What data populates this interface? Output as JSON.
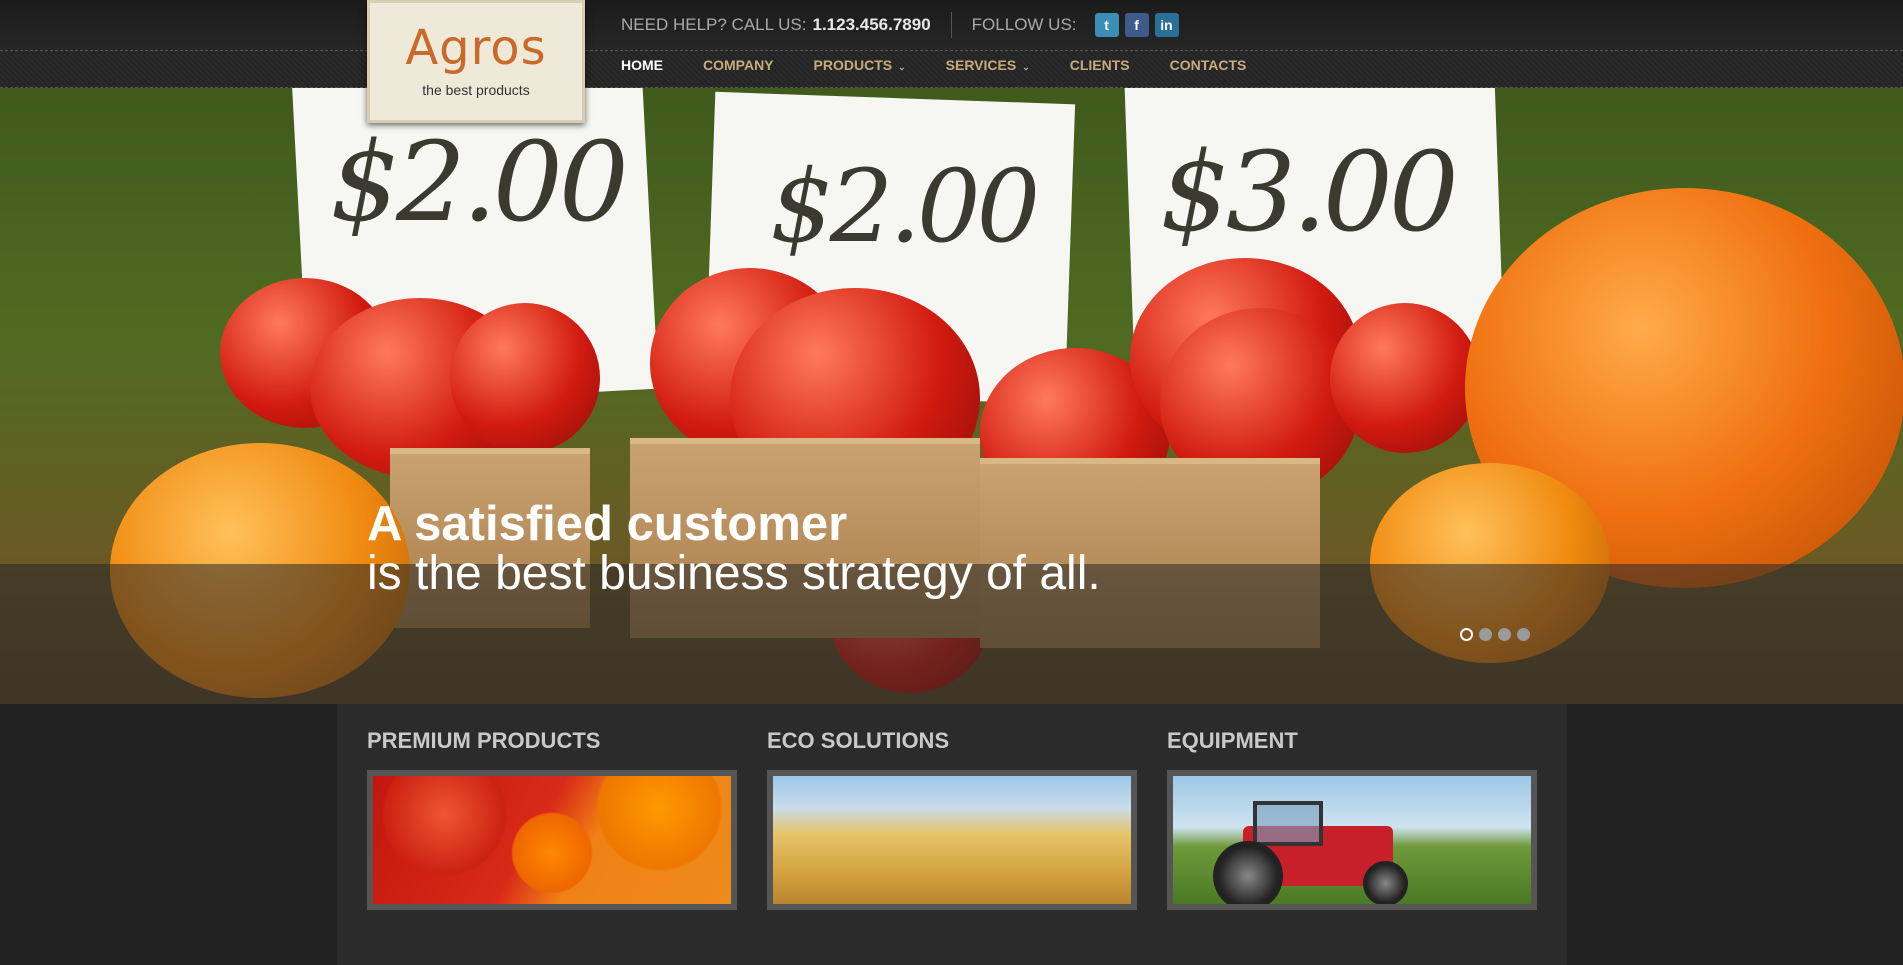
{
  "header": {
    "logo": {
      "name": "Agros",
      "tagline": "the best products"
    },
    "help_label": "NEED HELP? CALL US:",
    "phone": "1.123.456.7890",
    "follow_label": "FOLLOW US:",
    "social": [
      {
        "name": "twitter-icon",
        "glyph": "t"
      },
      {
        "name": "facebook-icon",
        "glyph": "f"
      },
      {
        "name": "linkedin-icon",
        "glyph": "in"
      }
    ]
  },
  "nav": {
    "items": [
      {
        "label": "HOME",
        "active": true
      },
      {
        "label": "COMPANY"
      },
      {
        "label": "PRODUCTS",
        "caret": "⌄"
      },
      {
        "label": "SERVICES",
        "caret": "⌄"
      },
      {
        "label": "CLIENTS"
      },
      {
        "label": "CONTACTS"
      }
    ]
  },
  "hero": {
    "headline": "A satisfied customer",
    "subline": "is the best business strategy of all.",
    "prices": [
      "$2.00",
      "$2.00",
      "$3.00"
    ],
    "slides_count": 4,
    "active_slide": 1
  },
  "features": [
    {
      "title": "PREMIUM PRODUCTS",
      "image": "tomatoes"
    },
    {
      "title": "ECO SOLUTIONS",
      "image": "wheat"
    },
    {
      "title": "EQUIPMENT",
      "image": "tractor"
    }
  ],
  "colors": {
    "accent": "#c8ab7d",
    "logo": "#c86a2a",
    "background": "#222222"
  }
}
